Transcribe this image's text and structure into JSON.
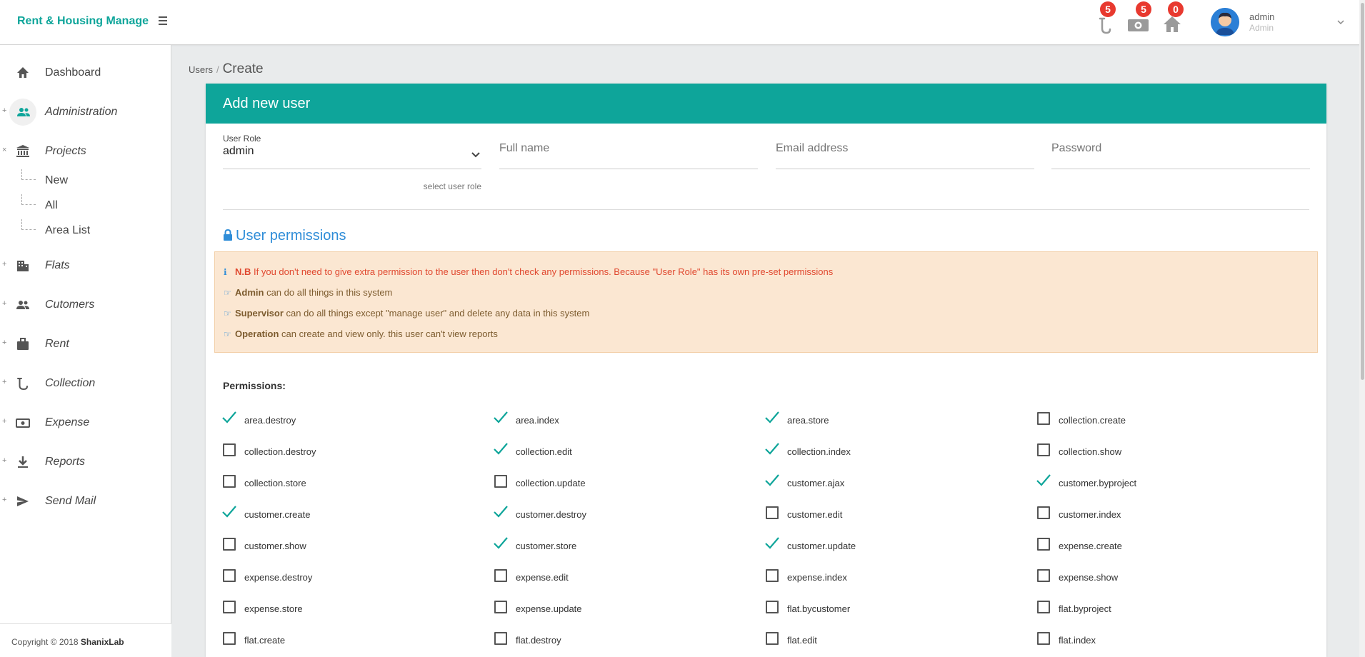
{
  "app": {
    "brand": "Rent & Housing Manage",
    "accent_color": "#0ea59a"
  },
  "topbar": {
    "icons": [
      {
        "name": "collection-icon",
        "badge": "5"
      },
      {
        "name": "money-icon",
        "badge": "5"
      },
      {
        "name": "home-icon",
        "badge": "0"
      }
    ],
    "user": {
      "name": "admin",
      "role": "Admin"
    }
  },
  "sidebar": {
    "items": [
      {
        "label": "Dashboard",
        "icon": "home-icon",
        "toggle": ""
      },
      {
        "label": "Administration",
        "icon": "users-icon",
        "toggle": "+"
      },
      {
        "label": "Projects",
        "icon": "bank-icon",
        "toggle": "×"
      },
      {
        "label": "Flats",
        "icon": "building-icon",
        "toggle": "+"
      },
      {
        "label": "Cutomers",
        "icon": "people-icon",
        "toggle": "+"
      },
      {
        "label": "Rent",
        "icon": "briefcase-icon",
        "toggle": "+"
      },
      {
        "label": "Collection",
        "icon": "collection-icon",
        "toggle": "+"
      },
      {
        "label": "Expense",
        "icon": "money-icon",
        "toggle": "+"
      },
      {
        "label": "Reports",
        "icon": "download-icon",
        "toggle": "+"
      },
      {
        "label": "Send Mail",
        "icon": "send-icon",
        "toggle": "+"
      }
    ],
    "project_subitems": [
      "New",
      "All",
      "Area List"
    ],
    "footer": {
      "copyright": "Copyright © 2018",
      "company": "ShanixLab"
    }
  },
  "breadcrumb": {
    "parent": "Users",
    "separator": "/",
    "current": "Create"
  },
  "form": {
    "title": "Add new user",
    "role": {
      "label": "User Role",
      "value": "admin",
      "help": "select user role"
    },
    "full_name": {
      "placeholder": "Full name"
    },
    "email": {
      "placeholder": "Email address"
    },
    "password": {
      "placeholder": "Password"
    }
  },
  "permissions_section": {
    "title": "User permissions",
    "notice": {
      "nb_label": "N.B",
      "nb_text": "If you don't need to give extra permission to the user then don't check any permissions. Because \"User Role\" has its own pre-set permissions",
      "admin_label": "Admin",
      "admin_text": "can do all things in this system",
      "supervisor_label": "Supervisor",
      "supervisor_text": "can do all things except \"manage user\" and delete any data in this system",
      "operation_label": "Operation",
      "operation_text": "can create and view only. this user can't view reports"
    },
    "heading": "Permissions:",
    "items": [
      {
        "name": "area.destroy",
        "checked": true
      },
      {
        "name": "area.index",
        "checked": true
      },
      {
        "name": "area.store",
        "checked": true
      },
      {
        "name": "collection.create",
        "checked": false
      },
      {
        "name": "collection.destroy",
        "checked": false
      },
      {
        "name": "collection.edit",
        "checked": true
      },
      {
        "name": "collection.index",
        "checked": true
      },
      {
        "name": "collection.show",
        "checked": false
      },
      {
        "name": "collection.store",
        "checked": false
      },
      {
        "name": "collection.update",
        "checked": false
      },
      {
        "name": "customer.ajax",
        "checked": true
      },
      {
        "name": "customer.byproject",
        "checked": true
      },
      {
        "name": "customer.create",
        "checked": true
      },
      {
        "name": "customer.destroy",
        "checked": true
      },
      {
        "name": "customer.edit",
        "checked": false
      },
      {
        "name": "customer.index",
        "checked": false
      },
      {
        "name": "customer.show",
        "checked": false
      },
      {
        "name": "customer.store",
        "checked": true
      },
      {
        "name": "customer.update",
        "checked": true
      },
      {
        "name": "expense.create",
        "checked": false
      },
      {
        "name": "expense.destroy",
        "checked": false
      },
      {
        "name": "expense.edit",
        "checked": false
      },
      {
        "name": "expense.index",
        "checked": false
      },
      {
        "name": "expense.show",
        "checked": false
      },
      {
        "name": "expense.store",
        "checked": false
      },
      {
        "name": "expense.update",
        "checked": false
      },
      {
        "name": "flat.bycustomer",
        "checked": false
      },
      {
        "name": "flat.byproject",
        "checked": false
      },
      {
        "name": "flat.create",
        "checked": false
      },
      {
        "name": "flat.destroy",
        "checked": false
      },
      {
        "name": "flat.edit",
        "checked": false
      },
      {
        "name": "flat.index",
        "checked": false
      }
    ]
  }
}
